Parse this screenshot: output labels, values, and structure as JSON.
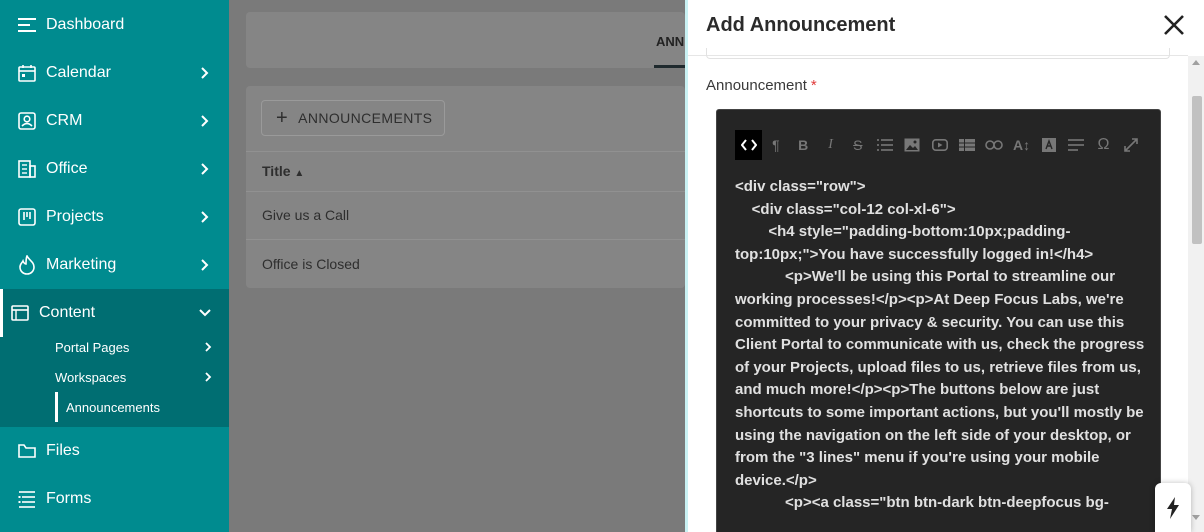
{
  "sidebar": {
    "items": [
      {
        "label": "Dashboard",
        "icon": "menu-icon"
      },
      {
        "label": "Calendar",
        "icon": "calendar-icon"
      },
      {
        "label": "CRM",
        "icon": "contact-icon"
      },
      {
        "label": "Office",
        "icon": "office-icon"
      },
      {
        "label": "Projects",
        "icon": "projects-icon"
      },
      {
        "label": "Marketing",
        "icon": "flame-icon"
      },
      {
        "label": "Content",
        "icon": "browser-icon"
      },
      {
        "label": "Files",
        "icon": "folder-icon"
      },
      {
        "label": "Forms",
        "icon": "form-icon"
      }
    ],
    "content_sub": [
      {
        "label": "Portal Pages"
      },
      {
        "label": "Workspaces"
      },
      {
        "label": "Announcements"
      }
    ]
  },
  "main": {
    "tab_label": "ANN",
    "add_button": "ANNOUNCEMENTS",
    "column_title": "Title",
    "rows": [
      "Give us a Call",
      "Office is Closed"
    ]
  },
  "panel": {
    "title": "Add Announcement",
    "field_label": "Announcement",
    "required_mark": "*",
    "code_lines": [
      "<div class=\"row\">",
      "    <div class=\"col-12 col-xl-6\">",
      "        <h4 style=\"padding-bottom:10px;padding-top:10px;\">You have successfully logged in!</h4>",
      "            <p>We'll be using this Portal to streamline our working processes!</p><p>At Deep Focus Labs, we're committed to your privacy & security. You can use this Client Portal to communicate with us, check the progress of your Projects, upload files to us, retrieve files from us, and much more!</p><p>The buttons below are just shortcuts to some important actions, but you'll mostly be using the navigation on the left side of your desktop, or from the \"3 lines\" menu if you're using your mobile device.</p>",
      "            <p><a class=\"btn btn-dark btn-deepfocus bg-"
    ],
    "toolbar": [
      "code-view-icon",
      "paragraph-icon",
      "bold-icon",
      "italic-icon",
      "strikethrough-icon",
      "list-icon",
      "image-icon",
      "video-icon",
      "table-icon",
      "link-icon",
      "font-size-icon",
      "text-color-icon",
      "align-icon",
      "special-char-icon",
      "fullscreen-icon"
    ]
  },
  "colors": {
    "sidebar": "#008b8f",
    "sidebar_active": "#006e72",
    "overlay": "#7a7a7a",
    "editor_bg": "#252525",
    "accent_border": "#c9f1f3"
  }
}
